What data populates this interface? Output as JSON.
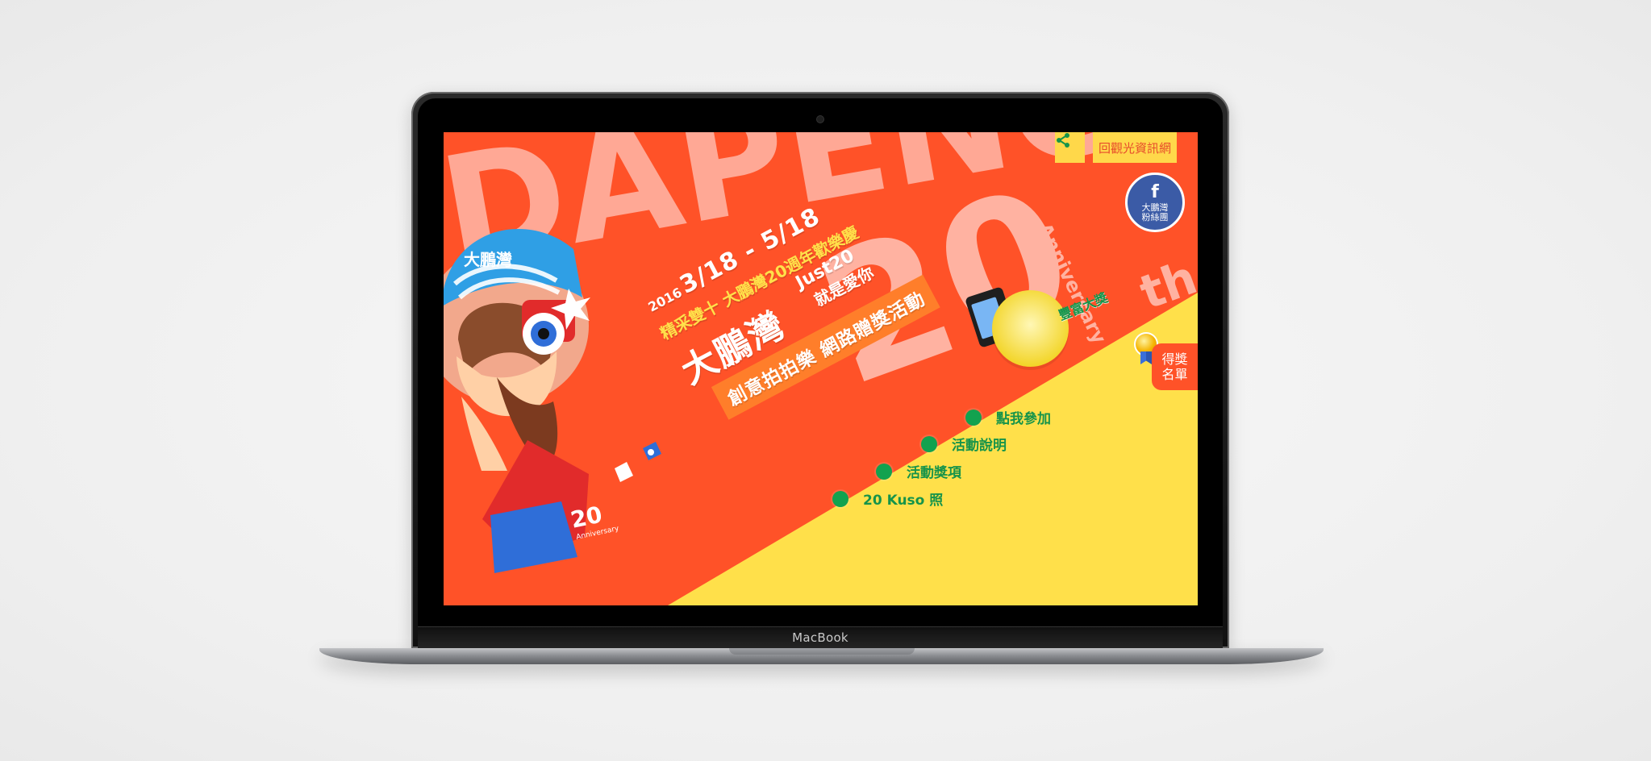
{
  "theme": {
    "background": "#f2f2f2",
    "screen_orange": "#ff5228",
    "screen_yellow": "#ffe04a",
    "accent_green": "#16944a",
    "facebook_blue": "#3b5ba6",
    "laptop_dark": "#111111",
    "aluminum": "#b6b8bb"
  },
  "device": {
    "brand_label": "MacBook"
  },
  "header": {
    "share_icon": "share-icon",
    "tourism_label": "回觀光資訊網"
  },
  "facebook": {
    "icon": "facebook-icon",
    "letter": "f",
    "line1": "大鵬灣",
    "line2": "粉絲團"
  },
  "winners": {
    "icon": "medal-icon",
    "line1": "得獎",
    "line2": "名單"
  },
  "hero": {
    "watermark_text": "DAPENG BAY",
    "anniversary_big": "20",
    "anniversary_suffix": "th",
    "anniversary_word": "Anniversary",
    "year": "2016",
    "dates": "3/18 - 5/18",
    "subtitle": "精采雙十 大鵬灣20週年歡樂慶",
    "brand": "大鵬灣",
    "tagline_top": "Just20",
    "tagline_bottom": "就是愛你",
    "strip": "創意拍拍樂 網路贈獎活動"
  },
  "prize": {
    "label": "豐富大獎"
  },
  "menu": {
    "items": [
      {
        "label": "點我參加"
      },
      {
        "label": "活動說明"
      },
      {
        "label": "活動獎項"
      },
      {
        "label": "20 Kuso 照"
      }
    ]
  },
  "mascot": {
    "hat_text": "大鵬灣",
    "shirt_number": "20",
    "shirt_text": "Anniversary"
  }
}
